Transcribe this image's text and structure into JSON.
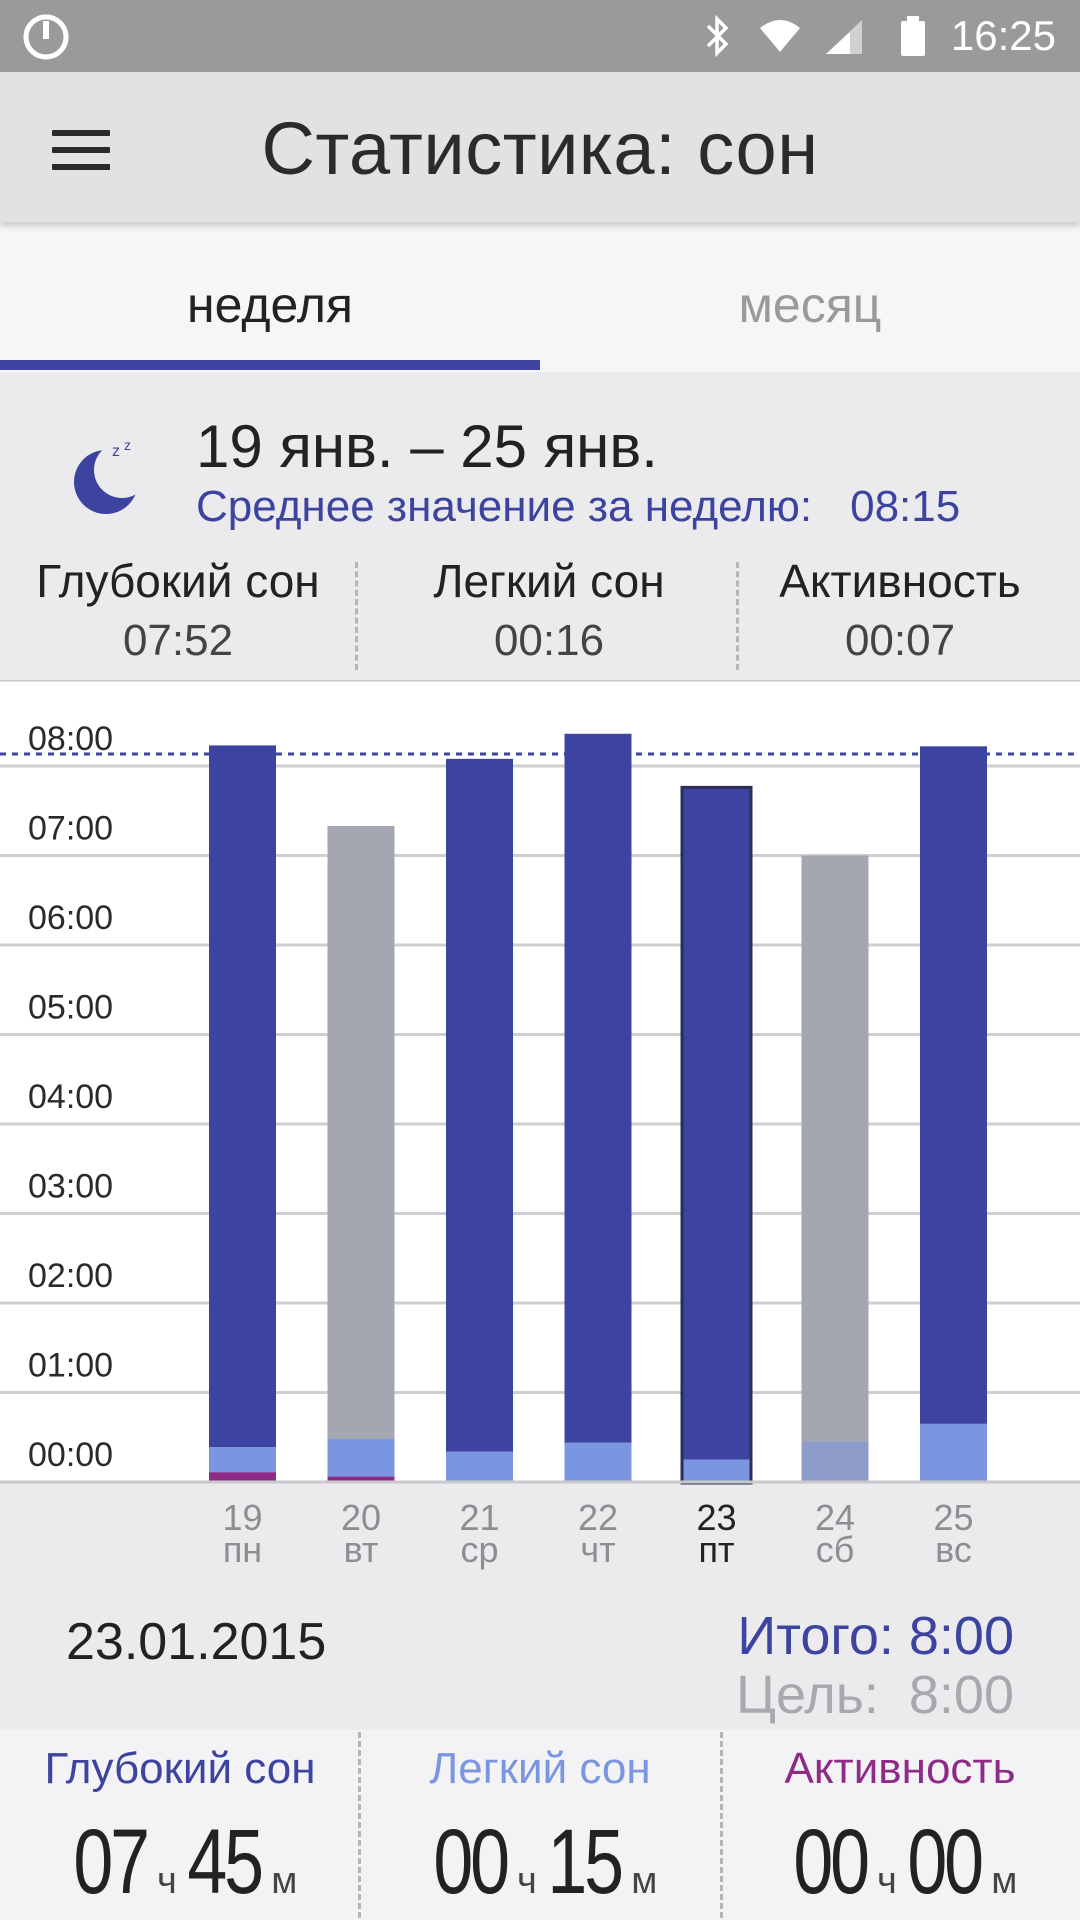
{
  "status_bar": {
    "time": "16:25",
    "icons": [
      "power-app-icon",
      "bluetooth-icon",
      "wifi-icon",
      "cellular-icon",
      "battery-icon"
    ]
  },
  "app_bar": {
    "title": "Статистика: сон",
    "menu_icon": "hamburger-menu-icon"
  },
  "tabs": [
    {
      "label": "неделя",
      "selected": true
    },
    {
      "label": "месяц",
      "selected": false
    }
  ],
  "summary": {
    "icon": "sleeping-moon-icon",
    "range": "19 янв. – 25 янв.",
    "average_label": "Среднее значение за неделю:",
    "average_value": "08:15",
    "stats": [
      {
        "label": "Глубокий сон",
        "value": "07:52"
      },
      {
        "label": "Легкий сон",
        "value": "00:16"
      },
      {
        "label": "Активность",
        "value": "00:07"
      }
    ]
  },
  "chart_data": {
    "type": "bar",
    "stacked": true,
    "y_tick_labels": [
      "00:00",
      "01:00",
      "02:00",
      "03:00",
      "04:00",
      "05:00",
      "06:00",
      "07:00",
      "08:00"
    ],
    "ylim_hours": [
      0,
      8.5
    ],
    "goal_line_hours": 8.0,
    "categories": [
      {
        "day": "19",
        "weekday": "пн"
      },
      {
        "day": "20",
        "weekday": "вт"
      },
      {
        "day": "21",
        "weekday": "ср"
      },
      {
        "day": "22",
        "weekday": "чт"
      },
      {
        "day": "23",
        "weekday": "пт"
      },
      {
        "day": "24",
        "weekday": "сб"
      },
      {
        "day": "25",
        "weekday": "вс"
      }
    ],
    "selected_index": 4,
    "series": [
      {
        "name": "Активность",
        "color": "#8e2a88",
        "values": [
          0.11,
          0.06,
          0,
          0,
          0,
          0,
          0
        ]
      },
      {
        "name": "Легкий сон",
        "color": "#7b96e0",
        "values": [
          0.28,
          0.42,
          0.34,
          0.44,
          0.25,
          0.45,
          0.65
        ]
      },
      {
        "name": "Глубокий сон",
        "color": "#3c43a0",
        "values": [
          7.84,
          0,
          7.74,
          7.92,
          7.5,
          0,
          7.57
        ]
      }
    ],
    "inactive_totals": [
      null,
      7.33,
      null,
      null,
      null,
      7.0,
      null
    ],
    "inactive_color": "#a4a7b2",
    "inactive_light_color": "#8e9ccc"
  },
  "detail": {
    "date": "23.01.2015",
    "total_label": "Итого: 8:00",
    "goal_label": "Цель:",
    "goal_value": "8:00",
    "columns": [
      {
        "label": "Глубокий сон",
        "color": "#3c44a0",
        "h": "07",
        "h_unit": "ч",
        "m": "45",
        "m_unit": "м"
      },
      {
        "label": "Легкий сон",
        "color": "#7b96e0",
        "h": "00",
        "h_unit": "ч",
        "m": "15",
        "m_unit": "м"
      },
      {
        "label": "Активность",
        "color": "#8e2a88",
        "h": "00",
        "h_unit": "ч",
        "m": "00",
        "m_unit": "м"
      }
    ]
  }
}
